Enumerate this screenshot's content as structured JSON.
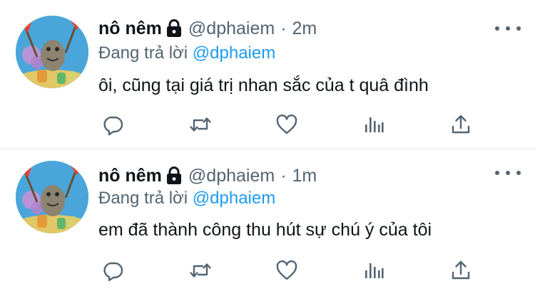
{
  "tweets": [
    {
      "author": {
        "display_name": "nô nêm",
        "handle": "@dphaiem",
        "avatar_icon": "cartoon-avatar",
        "protected_icon": "lock-icon"
      },
      "separator": "·",
      "time": "2m",
      "reply_prefix": "Đang trả lời",
      "reply_to": "@dphaiem",
      "text": "ôi, cũng tại giá trị nhan sắc của t quâ đình",
      "actions": [
        "reply-icon",
        "retweet-icon",
        "like-icon",
        "views-icon",
        "share-icon"
      ]
    },
    {
      "author": {
        "display_name": "nô nêm",
        "handle": "@dphaiem",
        "avatar_icon": "cartoon-avatar",
        "protected_icon": "lock-icon"
      },
      "separator": "·",
      "time": "1m",
      "reply_prefix": "Đang trả lời",
      "reply_to": "@dphaiem",
      "text": "em đã thành công thu hút sự chú ý của tôi",
      "actions": [
        "reply-icon",
        "retweet-icon",
        "like-icon",
        "views-icon",
        "share-icon"
      ]
    }
  ],
  "colors": {
    "text_primary": "#0f1419",
    "text_secondary": "#536471",
    "link": "#1d9bf0",
    "divider": "#eff3f4"
  },
  "more_menu_icon": "more-horizontal-icon"
}
